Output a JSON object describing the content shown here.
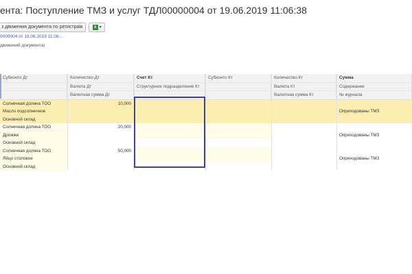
{
  "window": {
    "title": "ента: Поступление ТМЗ и услуг ТДЛ00000004 от 19.06.2019 11:06:38"
  },
  "toolbar": {
    "register_button": "з движения документа по регистрам",
    "export_icon": "excel-icon"
  },
  "doc_link": "0000004 от 19.06.2019 11:06...",
  "doc_note": "движений документа)",
  "table": {
    "headers": [
      [
        "Субконто Дт",
        "Количество Дт",
        "Счет Кт",
        "Субконто Кт",
        "Количество Кт",
        "Сумма"
      ],
      [
        "",
        "Валюта Дт",
        "Структурное подразделение Кт",
        "",
        "Валюта Кт",
        "Содержание"
      ],
      [
        "",
        "Валютная сумма Дт",
        "",
        "",
        "Валютная сумма Кт",
        "№ журнала"
      ]
    ],
    "rows": [
      {
        "lines": [
          {
            "subconto_dt": "Солнечная долина ТОО",
            "qty_dt": "10,000",
            "content": ""
          },
          {
            "subconto_dt": "Масло подсолнечное",
            "qty_dt": "",
            "content": "Оприходованы ТМЗ"
          },
          {
            "subconto_dt": "Основной склад",
            "qty_dt": "",
            "content": ""
          }
        ]
      },
      {
        "lines": [
          {
            "subconto_dt": "Солнечная долина ТОО",
            "qty_dt": "20,000",
            "content": ""
          },
          {
            "subconto_dt": "Дрожжи",
            "qty_dt": "",
            "content": "Оприходованы ТМЗ"
          },
          {
            "subconto_dt": "Основной склад",
            "qty_dt": "",
            "content": ""
          }
        ]
      },
      {
        "lines": [
          {
            "subconto_dt": "Солнечная долина ТОО",
            "qty_dt": "50,000",
            "content": ""
          },
          {
            "subconto_dt": "Яйцо столовое",
            "qty_dt": "",
            "content": "Оприходованы ТМЗ"
          },
          {
            "subconto_dt": "Основной склад",
            "qty_dt": "",
            "content": ""
          }
        ]
      }
    ]
  },
  "colors": {
    "selected_row": "#fbeeb0",
    "focus_border": "#3d3fae"
  }
}
